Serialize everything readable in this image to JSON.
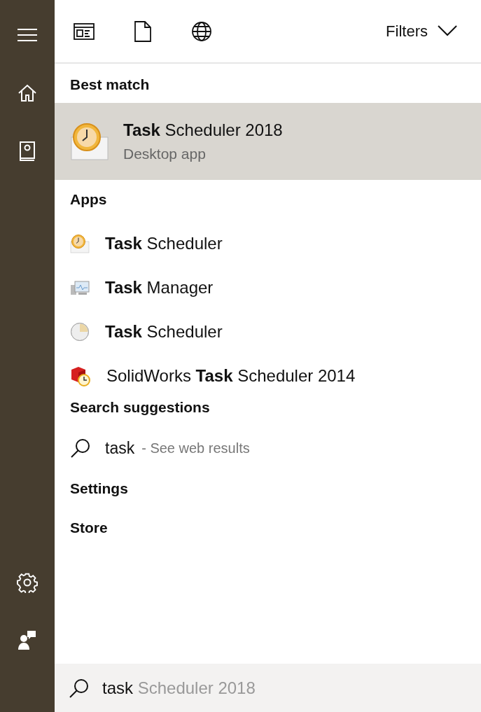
{
  "sidebar": {
    "top_items": [
      {
        "kind": "menu"
      },
      {
        "kind": "home"
      },
      {
        "kind": "notebook"
      }
    ],
    "bottom_items": [
      {
        "kind": "settings"
      },
      {
        "kind": "feedback"
      }
    ]
  },
  "filter_bar": {
    "scopes": [
      {
        "kind": "apps"
      },
      {
        "kind": "documents"
      },
      {
        "kind": "web"
      }
    ],
    "label": "Filters"
  },
  "best_match": {
    "heading": "Best match",
    "item": {
      "title": "**Task** Scheduler 2018",
      "subtitle": "Desktop app",
      "selected": true
    }
  },
  "apps": {
    "heading": "Apps",
    "items": [
      {
        "label": "**Task** Scheduler",
        "kind": "scheduler"
      },
      {
        "label": "**Task** Manager",
        "kind": "monitor"
      },
      {
        "label": "**Task** Scheduler",
        "kind": "clock"
      },
      {
        "label": "SolidWorks **Task** Scheduler 2014",
        "kind": "solidworks"
      }
    ]
  },
  "suggestions": {
    "heading": "Search suggestions",
    "items": [
      {
        "query": "task",
        "hint": "- See web results"
      }
    ]
  },
  "sections": [
    "Settings",
    "Store"
  ],
  "search": {
    "typed": "task",
    "completion": "Scheduler 2018"
  }
}
